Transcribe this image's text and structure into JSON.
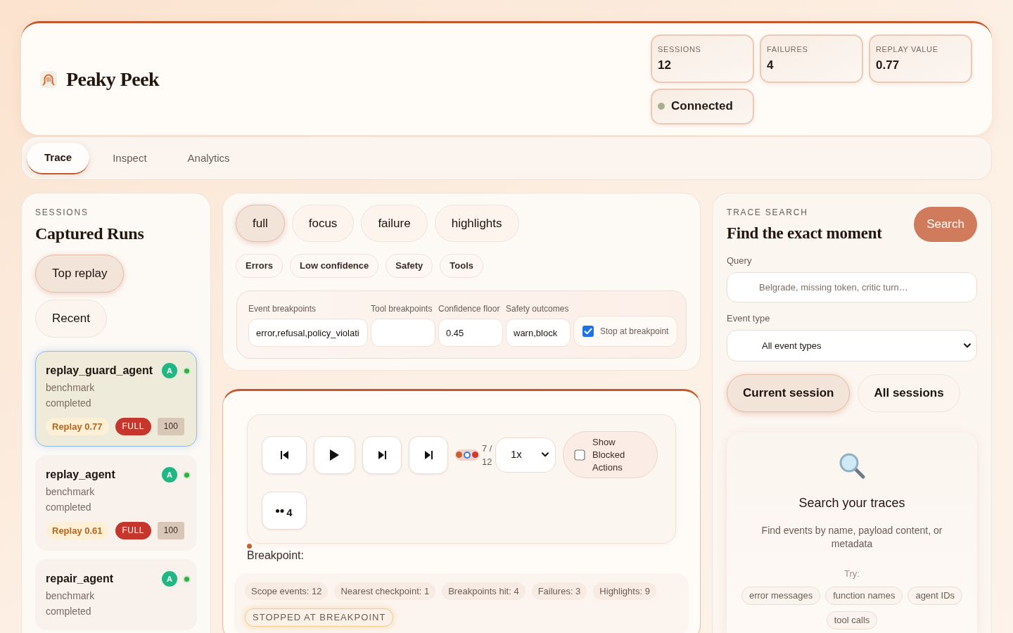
{
  "app": {
    "title": "Peaky Peek"
  },
  "header_stats": [
    {
      "label": "SESSIONS",
      "value": "12"
    },
    {
      "label": "FAILURES",
      "value": "4"
    },
    {
      "label": "REPLAY VALUE",
      "value": "0.77"
    }
  ],
  "connection": {
    "label": "Connected",
    "connected": true
  },
  "tabs": [
    {
      "label": "Trace",
      "selected": true
    },
    {
      "label": "Inspect",
      "selected": false
    },
    {
      "label": "Analytics",
      "selected": false
    }
  ],
  "sessions_panel": {
    "eyebrow": "SESSIONS",
    "title": "Captured Runs",
    "sort_options": [
      {
        "label": "Top replay",
        "selected": true
      },
      {
        "label": "Recent",
        "selected": false
      }
    ],
    "sessions": [
      {
        "name": "replay_guard_agent",
        "avatar": "A",
        "tag": "benchmark",
        "status": "completed",
        "selected": true,
        "replay": "Replay 0.77",
        "mode": "FULL",
        "count": "100"
      },
      {
        "name": "replay_agent",
        "avatar": "A",
        "tag": "benchmark",
        "status": "completed",
        "selected": false,
        "replay": "Replay 0.61",
        "mode": "FULL",
        "count": "100"
      },
      {
        "name": "repair_agent",
        "avatar": "A",
        "tag": "benchmark",
        "status": "completed",
        "selected": false
      }
    ]
  },
  "scope_modes": [
    {
      "label": "full",
      "selected": true
    },
    {
      "label": "focus",
      "selected": false
    },
    {
      "label": "failure",
      "selected": false
    },
    {
      "label": "highlights",
      "selected": false
    }
  ],
  "filter_chips": [
    "Errors",
    "Low confidence",
    "Safety",
    "Tools"
  ],
  "breakpoints": {
    "fields": [
      {
        "label": "Event breakpoints",
        "value": "error,refusal,policy_violati"
      },
      {
        "label": "Tool breakpoints"
      },
      {
        "label": "Confidence floor",
        "value": "0.45"
      },
      {
        "label": "Safety outcomes",
        "value": "warn,block"
      }
    ],
    "stop_at_breakpoint": {
      "label": "Stop at breakpoint",
      "checked": true
    }
  },
  "player": {
    "timeline": {
      "level": 0.5
    },
    "position": "7 / 12",
    "speed": "1x",
    "show_blocked": {
      "label": "Show Blocked Actions",
      "checked": false
    },
    "breakpoint_jump": "4",
    "breakpoint_label": "Breakpoint:"
  },
  "summary": {
    "stats": [
      "Scope events: 12",
      "Nearest checkpoint: 1",
      "Breakpoints hit: 4",
      "Failures: 3",
      "Highlights: 9"
    ],
    "status_badge": "STOPPED AT BREAKPOINT"
  },
  "search_panel": {
    "eyebrow": "TRACE SEARCH",
    "title": "Find the exact moment",
    "search_button": "Search",
    "query": {
      "label": "Query",
      "placeholder": "Belgrade, missing token, critic turn…"
    },
    "event_type": {
      "label": "Event type",
      "value": "All event types"
    },
    "scopes": [
      {
        "label": "Current session",
        "selected": true
      },
      {
        "label": "All sessions",
        "selected": false
      }
    ],
    "empty_state": {
      "title": "Search your traces",
      "description": "Find events by name, payload content, or metadata",
      "hint": "Try:",
      "suggestions": [
        "error messages",
        "function names",
        "agent IDs",
        "tool calls"
      ]
    }
  }
}
